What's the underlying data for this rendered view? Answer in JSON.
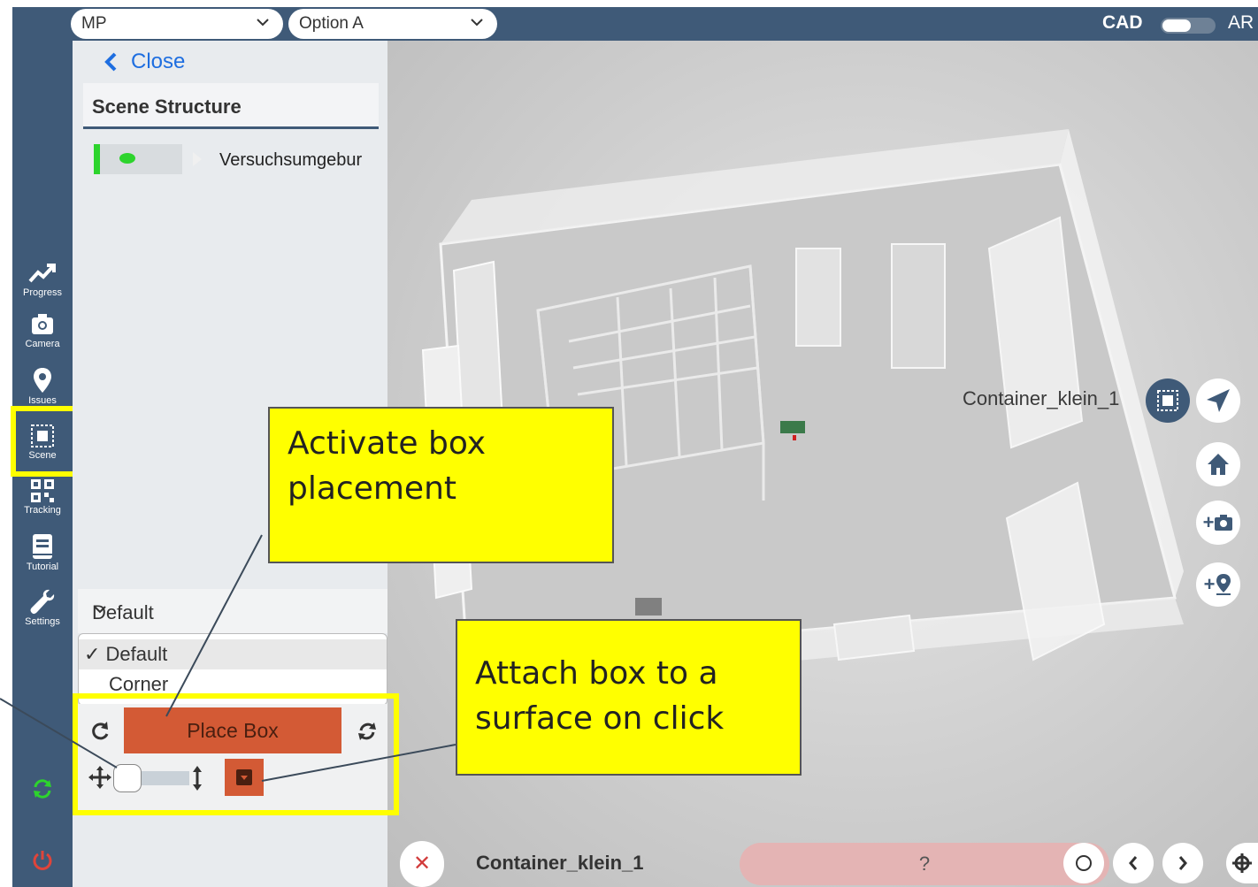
{
  "topbar": {
    "model_select": "MP",
    "option_select": "Option A",
    "cad_label": "CAD",
    "ar_label": "AR",
    "mode_toggle": "CAD"
  },
  "nav": {
    "items": [
      {
        "label": "Progress",
        "icon": "trend-up-icon"
      },
      {
        "label": "Camera",
        "icon": "camera-icon"
      },
      {
        "label": "Issues",
        "icon": "map-pin-icon"
      },
      {
        "label": "Scene",
        "icon": "scene-box-icon"
      },
      {
        "label": "Tracking",
        "icon": "qr-code-icon"
      },
      {
        "label": "Tutorial",
        "icon": "book-icon"
      },
      {
        "label": "Settings",
        "icon": "wrench-icon"
      }
    ],
    "active": "Scene",
    "sync_icon": "sync-icon",
    "power_icon": "power-icon"
  },
  "panel": {
    "close_label": "Close",
    "title": "Scene Structure",
    "tree": [
      {
        "name": "Versuchsumgebur",
        "visible": true
      }
    ],
    "placement_select": "Default",
    "placement_options": [
      "Default",
      "Corner"
    ],
    "selected_option": "✓ Default",
    "second_option": "Corner",
    "place_box_label": "Place Box"
  },
  "callouts": {
    "activate": [
      "Activate box",
      "placement"
    ],
    "attach": [
      "Attach box to a",
      "surface on click"
    ]
  },
  "viewport": {
    "object_label": "Container_klein_1"
  },
  "right_tools": {
    "add_photo": "+",
    "add_pin": "+"
  },
  "bottombar": {
    "object_name": "Container_klein_1",
    "status": "?"
  },
  "colors": {
    "nav_bg": "#3f5a78",
    "accent_orange": "#d35a35",
    "highlight": "#ffff00",
    "link_blue": "#1e6ee0",
    "visible_green": "#2dd42d"
  }
}
